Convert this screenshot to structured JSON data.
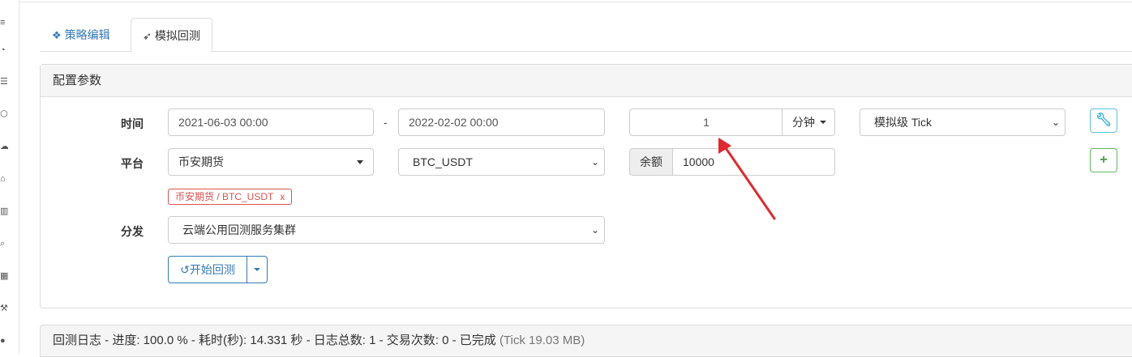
{
  "sidebar": {
    "icons": [
      "menu-icon",
      "dashboard-icon",
      "list-icon",
      "cube-icon",
      "cloud-icon",
      "bank-icon",
      "chart-icon",
      "search-icon",
      "calculator-icon",
      "tools-icon",
      "chat-icon"
    ]
  },
  "tabs": [
    {
      "label": "策略编辑",
      "icon": "cubes-icon",
      "active": false
    },
    {
      "label": "模拟回测",
      "icon": "rocket-icon",
      "active": true
    }
  ],
  "config": {
    "title": "配置参数",
    "time_label": "时间",
    "start_time": "2021-06-03 00:00",
    "separator": "-",
    "end_time": "2022-02-02 00:00",
    "period_value": "1",
    "period_unit": "分钟",
    "tick_mode": "模拟级 Tick",
    "platform_label": "平台",
    "exchange": "币安期货",
    "pair": "BTC_USDT",
    "balance_label": "余额",
    "balance_value": "10000",
    "selected_tag": "币安期货 / BTC_USDT",
    "tag_close": "x",
    "dispatch_label": "分发",
    "dispatch_value": "云端公用回测服务集群",
    "start_button": "开始回测"
  },
  "log": {
    "text": "回测日志 - 进度: 100.0 % - 耗时(秒): 14.331 秒 - 日志总数: 1 - 交易次数: 0 - 已完成",
    "size": "(Tick 19.03 MB)"
  },
  "colors": {
    "link_blue": "#337ab7",
    "danger_red": "#d9534f",
    "success_green": "#5cb85c",
    "info_cyan": "#5bc0de",
    "annotation_arrow": "#e0282e"
  }
}
